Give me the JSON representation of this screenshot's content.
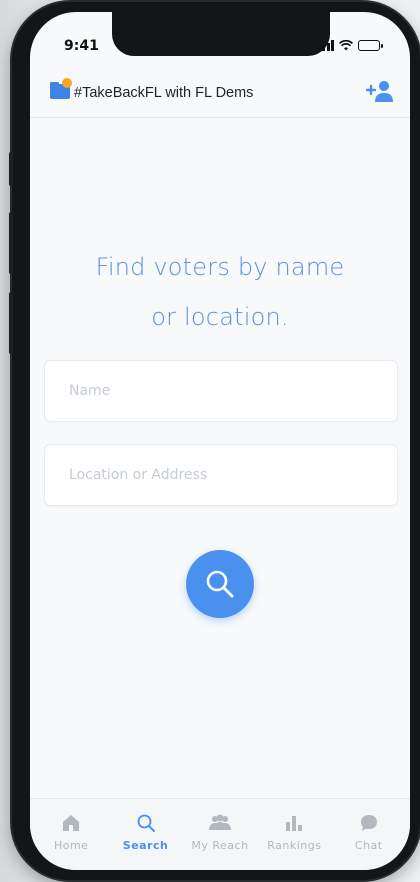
{
  "status_bar": {
    "time": "9:41"
  },
  "header": {
    "title": "#TakeBackFL with FL Dems",
    "logo_icon": "folder-dot-icon",
    "action_icon": "add-person-icon"
  },
  "search": {
    "headline_line1": "Find voters by name",
    "headline_line2": "or location.",
    "name_placeholder": "Name",
    "location_placeholder": "Location or Address",
    "button_icon": "search-icon"
  },
  "tabs": [
    {
      "label": "Home",
      "icon": "home-icon",
      "active": false
    },
    {
      "label": "Search",
      "icon": "search-icon",
      "active": true
    },
    {
      "label": "My Reach",
      "icon": "people-icon",
      "active": false
    },
    {
      "label": "Rankings",
      "icon": "bar-chart-icon",
      "active": false
    },
    {
      "label": "Chat",
      "icon": "chat-icon",
      "active": false
    }
  ],
  "colors": {
    "accent": "#4a90ee",
    "headline": "#5b8fe0",
    "logo_orange": "#f5a623",
    "inactive_tab": "#b3b8bf"
  }
}
